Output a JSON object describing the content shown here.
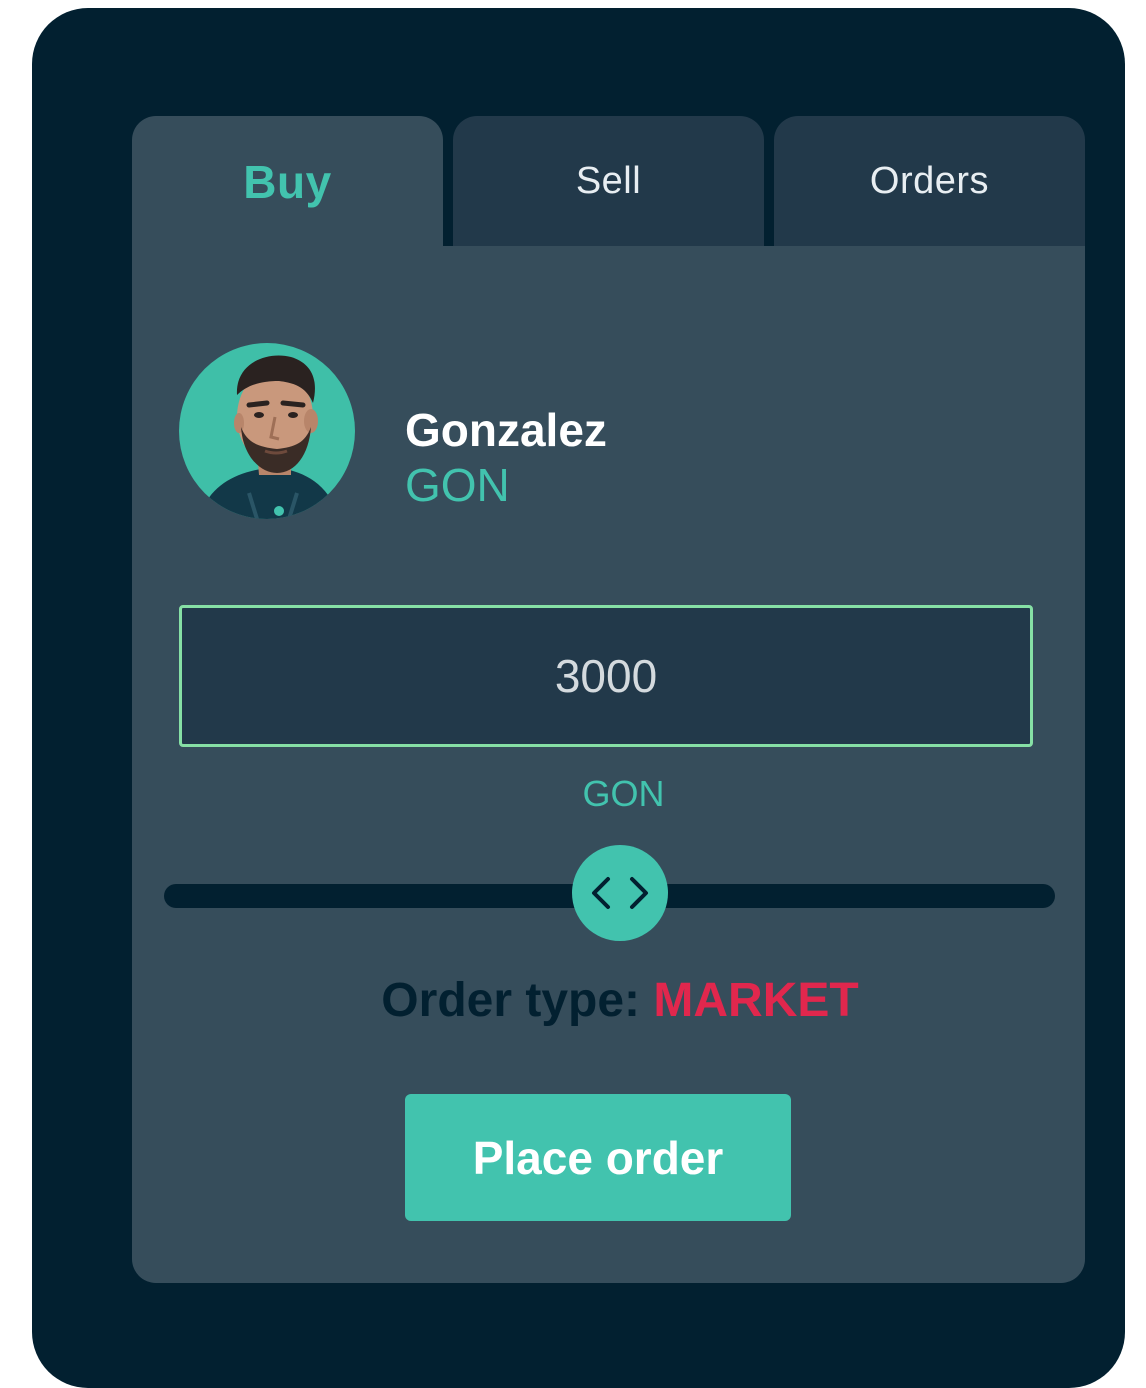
{
  "tabs": {
    "buy": "Buy",
    "sell": "Sell",
    "orders": "Orders",
    "active": "buy"
  },
  "player": {
    "name": "Gonzalez",
    "ticker": "GON"
  },
  "amount": {
    "value": "3000",
    "unit": "GON"
  },
  "slider": {
    "level_percent": 51,
    "icon": "chevron-left-right-icon"
  },
  "order": {
    "type_label": "Order type:",
    "type_value": "MARKET"
  },
  "place_order": {
    "label": "Place order"
  },
  "colors": {
    "background": "#022030",
    "panel": "#364d5b",
    "inactive_tab": "#22394a",
    "accent": "#42c3ae",
    "input_border": "#86e0a5",
    "market": "#e1274d"
  }
}
